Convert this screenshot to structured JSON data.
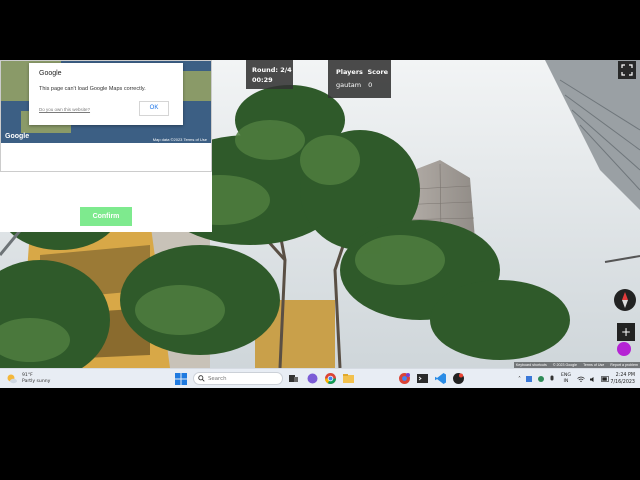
{
  "map_dialog": {
    "title": "Google",
    "message": "This page can't load Google Maps correctly.",
    "link": "Do you own this website?",
    "ok_label": "OK"
  },
  "minimap": {
    "logo": "Google",
    "attribution": "Map data ©2023   Terms of Use"
  },
  "confirm_label": "Confirm",
  "hud": {
    "round_label": "Round: 2/4",
    "timer": "00:29",
    "players_header": "Players",
    "score_header": "Score",
    "player_name": "gautam",
    "player_score": "0"
  },
  "streetview_footer": {
    "shortcuts": "Keyboard shortcuts",
    "copyright": "© 2023 Google",
    "terms": "Terms of Use",
    "report": "Report a problem"
  },
  "taskbar": {
    "weather_temp": "91°F",
    "weather_desc": "Partly sunny",
    "search_placeholder": "Search",
    "language": "ENG",
    "region": "IN",
    "time": "2:24 PM",
    "date": "7/16/2023"
  },
  "colors": {
    "confirm_green": "#7eea8e",
    "hud_bg": "#323232",
    "taskbar_bg": "#e8edf4"
  }
}
